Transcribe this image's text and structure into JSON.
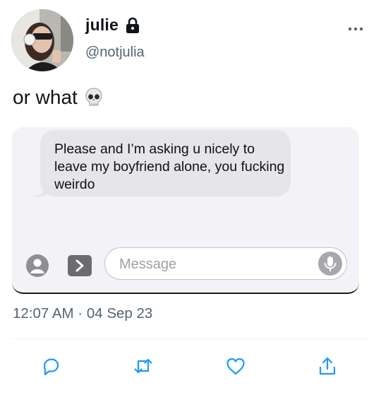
{
  "tweet": {
    "author": {
      "display_name": "julie",
      "handle": "@notjulia",
      "protected_icon": "lock-icon",
      "avatar": "profile-photo"
    },
    "text": "or what",
    "emoji": "skull-icon",
    "timestamp": "12:07 AM · 04 Sep 23",
    "more_icon": "more-options-icon"
  },
  "screenshot": {
    "received_message": "Please and I’m asking u nicely to leave my boyfriend alone, you fucking weirdo",
    "input_placeholder": "Message",
    "bubble_color": "#e5e5ea",
    "background_color": "#f2f2f7"
  },
  "actions": [
    "reply-icon",
    "retweet-icon",
    "like-icon",
    "share-icon"
  ],
  "colors": {
    "text": "#0f1419",
    "secondary": "#536471",
    "icon": "#1d9bf0"
  }
}
